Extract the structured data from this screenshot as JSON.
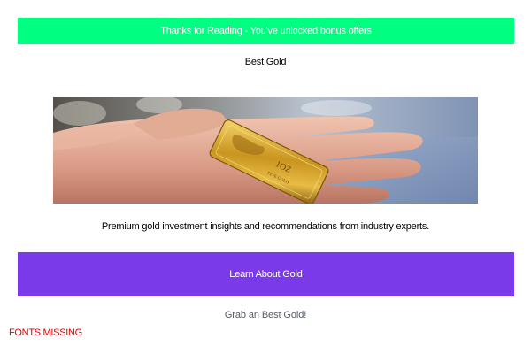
{
  "banner": {
    "text": "Thanks for Reading - You've unlocked bonus offers",
    "background": "#00ff80"
  },
  "brand": {
    "title": "Best Gold"
  },
  "hero": {
    "image_subject": "hand holding gold bar",
    "icon": "gold-bar-photo"
  },
  "description": {
    "text": "Premium gold investment insights and recommendations from industry experts."
  },
  "cta": {
    "label": "Learn About Gold",
    "background": "#7b3aea"
  },
  "footer": {
    "link_text": "Grab an Best Gold!"
  },
  "warning": {
    "text": "FONTS MISSING",
    "color": "#e00000"
  }
}
